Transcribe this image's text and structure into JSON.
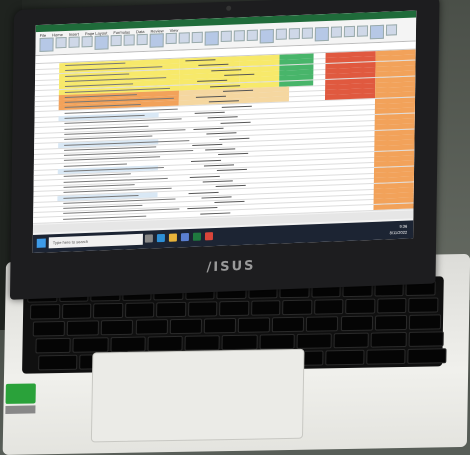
{
  "scene": {
    "description_type": "photo",
    "laptop_brand": "/ISUS",
    "screen": {
      "app": "spreadsheet",
      "ribbon_tabs": [
        "File",
        "Home",
        "Insert",
        "Page Layout",
        "Formulas",
        "Data",
        "Review",
        "View"
      ],
      "taskbar": {
        "search_placeholder": "Type here to search",
        "clock": "9:36",
        "date": "8/11/2022"
      }
    }
  },
  "colors": {
    "yellow": "#f7e96a",
    "orange": "#f2a25a",
    "green": "#48b56a",
    "red": "#e0593f"
  }
}
